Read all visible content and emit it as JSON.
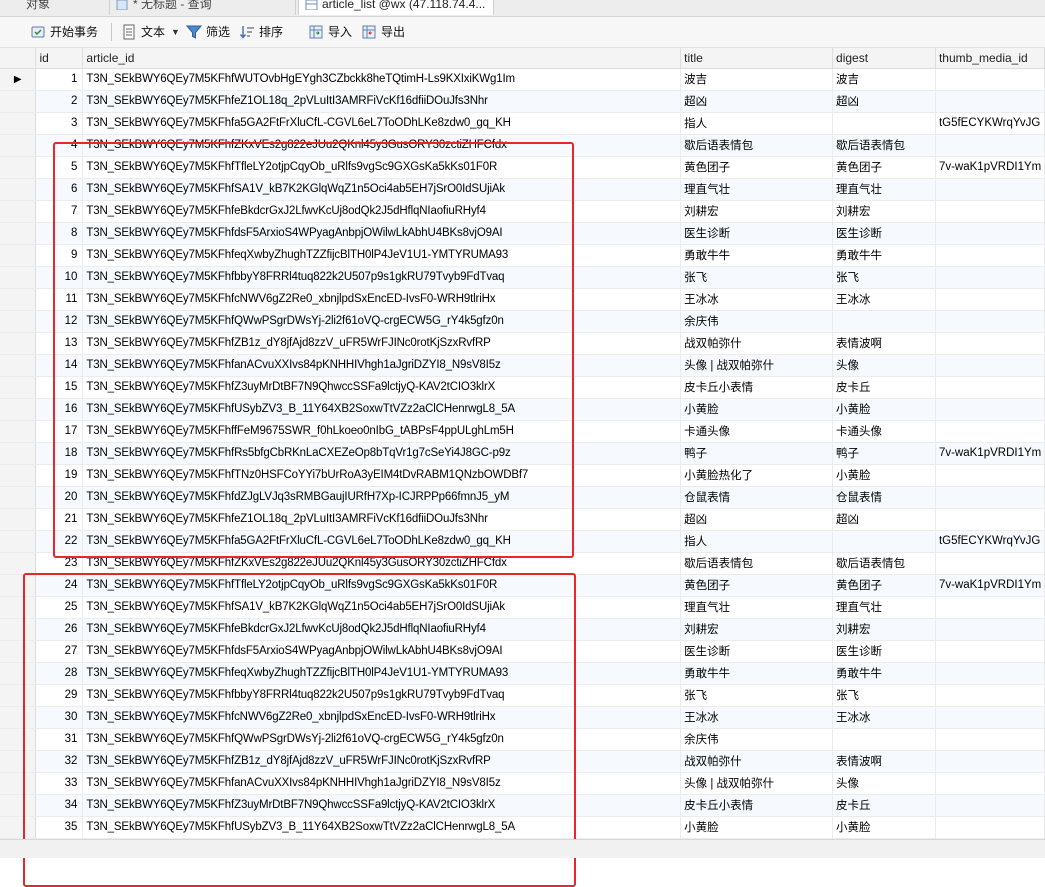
{
  "tabs": [
    {
      "label": "对象"
    },
    {
      "label": "* 无标题 - 查询"
    },
    {
      "label": "article_list @wx (47.118.74.4..."
    }
  ],
  "toolbar": {
    "begin_transaction": "开始事务",
    "text": "文本",
    "filter": "筛选",
    "sort": "排序",
    "import": "导入",
    "export": "导出"
  },
  "table": {
    "columns": [
      "id",
      "article_id",
      "title",
      "digest",
      "thumb_media_id"
    ],
    "rows": [
      {
        "id": "1",
        "article_id": "T3N_SEkBWY6QEy7M5KFhfWUTOvbHgEYgh3CZbckk8heTQtimH-Ls9KXIxiKWg1Im",
        "title": "波吉",
        "digest": "波吉",
        "thumb": ""
      },
      {
        "id": "2",
        "article_id": "T3N_SEkBWY6QEy7M5KFhfeZ1OL18q_2pVLuItI3AMRFiVcKf16dfiiDOuJfs3Nhr",
        "title": "超凶",
        "digest": "超凶",
        "thumb": ""
      },
      {
        "id": "3",
        "article_id": "T3N_SEkBWY6QEy7M5KFhfa5GA2FtFrXluCfL-CGVL6eL7ToODhLKe8zdw0_gq_KH",
        "title": "指人",
        "digest": "",
        "thumb": "tG5fECYKWrqYvJG"
      },
      {
        "id": "4",
        "article_id": "T3N_SEkBWY6QEy7M5KFhfZKxVEs2g822eJUu2QKnl45y3GusORY30zctiZHFCfdx",
        "title": "歇后语表情包",
        "digest": "歇后语表情包",
        "thumb": ""
      },
      {
        "id": "5",
        "article_id": "T3N_SEkBWY6QEy7M5KFhfTfleLY2otjpCqyOb_uRlfs9vgSc9GXGsKa5kKs01F0R",
        "title": "黄色团子",
        "digest": "黄色团子",
        "thumb": "7v-waK1pVRDI1Ym"
      },
      {
        "id": "6",
        "article_id": "T3N_SEkBWY6QEy7M5KFhfSA1V_kB7K2KGlqWqZ1n5Oci4ab5EH7jSrO0IdSUjiAk",
        "title": "理直气壮",
        "digest": "理直气壮",
        "thumb": ""
      },
      {
        "id": "7",
        "article_id": "T3N_SEkBWY6QEy7M5KFhfeBkdcrGxJ2LfwvKcUj8odQk2J5dHflqNIaofiuRHyf4",
        "title": "刘耕宏",
        "digest": "刘耕宏",
        "thumb": ""
      },
      {
        "id": "8",
        "article_id": "T3N_SEkBWY6QEy7M5KFhfdsF5ArxioS4WPyagAnbpjOWilwLkAbhU4BKs8vjO9AI",
        "title": "医生诊断",
        "digest": "医生诊断",
        "thumb": ""
      },
      {
        "id": "9",
        "article_id": "T3N_SEkBWY6QEy7M5KFhfeqXwbyZhughTZZfijcBlTH0lP4JeV1U1-YMTYRUMA93",
        "title": "勇敢牛牛",
        "digest": "勇敢牛牛",
        "thumb": ""
      },
      {
        "id": "10",
        "article_id": "T3N_SEkBWY6QEy7M5KFhfbbyY8FRRl4tuq822k2U507p9s1gkRU79Tvyb9FdTvaq",
        "title": "张飞",
        "digest": "张飞",
        "thumb": ""
      },
      {
        "id": "11",
        "article_id": "T3N_SEkBWY6QEy7M5KFhfcNWV6gZ2Re0_xbnjlpdSxEncED-IvsF0-WRH9tlriHx",
        "title": "王冰冰",
        "digest": "王冰冰",
        "thumb": ""
      },
      {
        "id": "12",
        "article_id": "T3N_SEkBWY6QEy7M5KFhfQWwPSgrDWsYj-2li2f61oVQ-crgECW5G_rY4k5gfz0n",
        "title": "余庆伟",
        "digest": "",
        "thumb": ""
      },
      {
        "id": "13",
        "article_id": "T3N_SEkBWY6QEy7M5KFhfZB1z_dY8jfAjd8zzV_uFR5WrFJINc0rotKjSzxRvfRP",
        "title": "战双帕弥什",
        "digest": "表情波啊",
        "thumb": ""
      },
      {
        "id": "14",
        "article_id": "T3N_SEkBWY6QEy7M5KFhfanACvuXXIvs84pKNHHIVhgh1aJgriDZYI8_N9sV8I5z",
        "title": "头像 | 战双帕弥什",
        "digest": "头像",
        "thumb": ""
      },
      {
        "id": "15",
        "article_id": "T3N_SEkBWY6QEy7M5KFhfZ3uyMrDtBF7N9QhwccSSFa9lctjyQ-KAV2tCIO3klrX",
        "title": "皮卡丘小表情",
        "digest": "皮卡丘",
        "thumb": ""
      },
      {
        "id": "16",
        "article_id": "T3N_SEkBWY6QEy7M5KFhfUSybZV3_B_11Y64XB2SoxwTtVZz2aClCHenrwgL8_5A",
        "title": "小黄脸",
        "digest": "小黄脸",
        "thumb": ""
      },
      {
        "id": "17",
        "article_id": "T3N_SEkBWY6QEy7M5KFhffFeM9675SWR_f0hLkoeo0nIbG_tABPsF4ppULghLm5H",
        "title": "卡通头像",
        "digest": "卡通头像",
        "thumb": ""
      },
      {
        "id": "18",
        "article_id": "T3N_SEkBWY6QEy7M5KFhfRs5bfgCbRKnLaCXEZeOp8bTqVr1g7cSeYi4J8GC-p9z",
        "title": "鸭子",
        "digest": "鸭子",
        "thumb": "7v-waK1pVRDI1Ym"
      },
      {
        "id": "19",
        "article_id": "T3N_SEkBWY6QEy7M5KFhfTNz0HSFCoYYi7bUrRoA3yEIM4tDvRABM1QNzbOWDBf7",
        "title": "小黄脸热化了",
        "digest": "小黄脸",
        "thumb": ""
      },
      {
        "id": "20",
        "article_id": "T3N_SEkBWY6QEy7M5KFhfdZJgLVJq3sRMBGaujIURfH7Xp-ICJRPPp66fmnJ5_yM",
        "title": "仓鼠表情",
        "digest": "仓鼠表情",
        "thumb": ""
      },
      {
        "id": "21",
        "article_id": "T3N_SEkBWY6QEy7M5KFhfeZ1OL18q_2pVLuItI3AMRFiVcKf16dfiiDOuJfs3Nhr",
        "title": "超凶",
        "digest": "超凶",
        "thumb": ""
      },
      {
        "id": "22",
        "article_id": "T3N_SEkBWY6QEy7M5KFhfa5GA2FtFrXluCfL-CGVL6eL7ToODhLKe8zdw0_gq_KH",
        "title": "指人",
        "digest": "",
        "thumb": "tG5fECYKWrqYvJG"
      },
      {
        "id": "23",
        "article_id": "T3N_SEkBWY6QEy7M5KFhfZKxVEs2g822eJUu2QKnl45y3GusORY30zctiZHFCfdx",
        "title": "歇后语表情包",
        "digest": "歇后语表情包",
        "thumb": ""
      },
      {
        "id": "24",
        "article_id": "T3N_SEkBWY6QEy7M5KFhfTfleLY2otjpCqyOb_uRlfs9vgSc9GXGsKa5kKs01F0R",
        "title": "黄色团子",
        "digest": "黄色团子",
        "thumb": "7v-waK1pVRDI1Ym"
      },
      {
        "id": "25",
        "article_id": "T3N_SEkBWY6QEy7M5KFhfSA1V_kB7K2KGlqWqZ1n5Oci4ab5EH7jSrO0IdSUjiAk",
        "title": "理直气壮",
        "digest": "理直气壮",
        "thumb": ""
      },
      {
        "id": "26",
        "article_id": "T3N_SEkBWY6QEy7M5KFhfeBkdcrGxJ2LfwvKcUj8odQk2J5dHflqNIaofiuRHyf4",
        "title": "刘耕宏",
        "digest": "刘耕宏",
        "thumb": ""
      },
      {
        "id": "27",
        "article_id": "T3N_SEkBWY6QEy7M5KFhfdsF5ArxioS4WPyagAnbpjOWilwLkAbhU4BKs8vjO9AI",
        "title": "医生诊断",
        "digest": "医生诊断",
        "thumb": ""
      },
      {
        "id": "28",
        "article_id": "T3N_SEkBWY6QEy7M5KFhfeqXwbyZhughTZZfijcBlTH0lP4JeV1U1-YMTYRUMA93",
        "title": "勇敢牛牛",
        "digest": "勇敢牛牛",
        "thumb": ""
      },
      {
        "id": "29",
        "article_id": "T3N_SEkBWY6QEy7M5KFhfbbyY8FRRl4tuq822k2U507p9s1gkRU79Tvyb9FdTvaq",
        "title": "张飞",
        "digest": "张飞",
        "thumb": ""
      },
      {
        "id": "30",
        "article_id": "T3N_SEkBWY6QEy7M5KFhfcNWV6gZ2Re0_xbnjlpdSxEncED-IvsF0-WRH9tlriHx",
        "title": "王冰冰",
        "digest": "王冰冰",
        "thumb": ""
      },
      {
        "id": "31",
        "article_id": "T3N_SEkBWY6QEy7M5KFhfQWwPSgrDWsYj-2li2f61oVQ-crgECW5G_rY4k5gfz0n",
        "title": "余庆伟",
        "digest": "",
        "thumb": ""
      },
      {
        "id": "32",
        "article_id": "T3N_SEkBWY6QEy7M5KFhfZB1z_dY8jfAjd8zzV_uFR5WrFJINc0rotKjSzxRvfRP",
        "title": "战双帕弥什",
        "digest": "表情波啊",
        "thumb": ""
      },
      {
        "id": "33",
        "article_id": "T3N_SEkBWY6QEy7M5KFhfanACvuXXIvs84pKNHHIVhgh1aJgriDZYI8_N9sV8I5z",
        "title": "头像 | 战双帕弥什",
        "digest": "头像",
        "thumb": ""
      },
      {
        "id": "34",
        "article_id": "T3N_SEkBWY6QEy7M5KFhfZ3uyMrDtBF7N9QhwccSSFa9lctjyQ-KAV2tCIO3klrX",
        "title": "皮卡丘小表情",
        "digest": "皮卡丘",
        "thumb": ""
      },
      {
        "id": "35",
        "article_id": "T3N_SEkBWY6QEy7M5KFhfUSybZV3_B_11Y64XB2SoxwTtVZz2aClCHenrwgL8_5A",
        "title": "小黄脸",
        "digest": "小黄脸",
        "thumb": ""
      }
    ]
  },
  "annotation_color": "#e8262b",
  "icons": {
    "begin_transaction": "transaction-icon",
    "text": "text-document-icon",
    "filter": "funnel-icon",
    "sort": "sort-icon",
    "import": "import-icon",
    "export": "export-icon",
    "current_row": "row-pointer-icon"
  }
}
